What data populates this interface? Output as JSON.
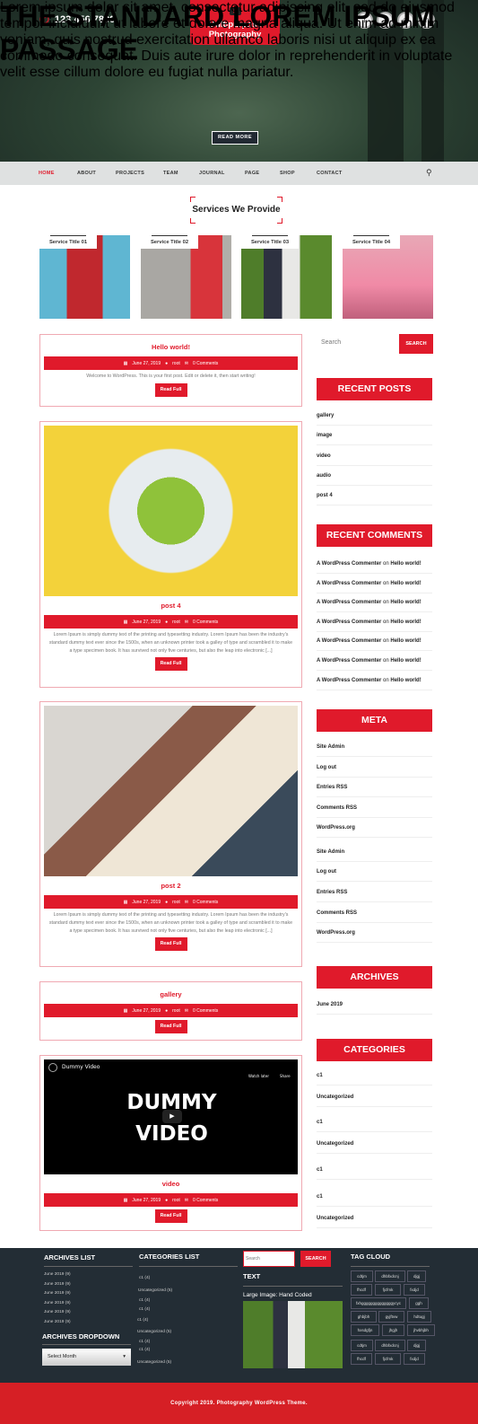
{
  "header": {
    "phone": "123 456 7890",
    "logo_line1": "Multipurpose",
    "logo_line2": "Photography",
    "social": [
      "facebook-icon",
      "twitter-icon",
      "instagram-icon",
      "linkedin-icon"
    ]
  },
  "hero": {
    "title": "THE STANDARD LOREM IPSUM PASSAGE",
    "text": "Lorem ipsum dolor sit amet, consectetur adipiscing elit, sed do eiusmod tempor incididunt ut labore et dolore magna aliqua. Ut enim ad minim veniam, quis nostrud exercitation ullamco laboris nisi ut aliquip ex ea commodo consequat. Duis aute irure dolor in reprehenderit in voluptate velit esse cillum dolore eu fugiat nulla pariatur.",
    "button": "READ MORE"
  },
  "nav": {
    "items": [
      "HOME",
      "ABOUT",
      "PROJECTS",
      "TEAM",
      "JOURNAL",
      "PAGE",
      "SHOP",
      "CONTACT"
    ],
    "active": "HOME"
  },
  "services": {
    "heading": "Services We Provide",
    "items": [
      "Service Title 01",
      "Service Title 02",
      "Service Title 03",
      "Service Title 04"
    ]
  },
  "posts": [
    {
      "title": "Hello world!",
      "date": "June 27, 2019",
      "author": "root",
      "comments": "0 Comments",
      "excerpt": "Welcome to WordPress. This is your first post. Edit or delete it, then start writing!",
      "button": "Read Full"
    },
    {
      "title": "post 4",
      "date": "June 27, 2019",
      "author": "root",
      "comments": "0 Comments",
      "excerpt": "Lorem Ipsum is simply dummy text of the printing and typesetting industry. Lorem Ipsum has been the industry's standard dummy text ever since the 1500s, when an unknown printer took a galley of type and scrambled it to make a type specimen book. It has survived not only five centuries, but also the leap into electronic [...]",
      "button": "Read Full"
    },
    {
      "title": "post 2",
      "date": "June 27, 2019",
      "author": "root",
      "comments": "0 Comments",
      "excerpt": "Lorem Ipsum is simply dummy text of the printing and typesetting industry. Lorem Ipsum has been the industry's standard dummy text ever since the 1500s, when an unknown printer took a galley of type and scrambled it to make a type specimen book. It has survived not only five centuries, but also the leap into electronic [...]",
      "button": "Read Full"
    },
    {
      "title": "gallery",
      "date": "June 27, 2019",
      "author": "root",
      "comments": "0 Comments",
      "button": "Read Full"
    },
    {
      "title": "video",
      "date": "June 27, 2019",
      "author": "root",
      "comments": "0 Comments",
      "button": "Read Full",
      "video": {
        "channel_title": "Dummy Video",
        "big_text_1": "DUMMY",
        "big_text_2": "VIDEO",
        "watch_later": "Watch later",
        "share": "Share"
      }
    }
  ],
  "sidebar": {
    "search_placeholder": "Search",
    "search_button": "SEARCH",
    "recent_posts_title": "RECENT POSTS",
    "recent_posts": [
      "gallery",
      "image",
      "video",
      "audio",
      "post 4"
    ],
    "recent_comments_title": "RECENT COMMENTS",
    "recent_comments": {
      "author": "A WordPress Commenter",
      "on": "on",
      "post": "Hello world!",
      "count": 7
    },
    "meta_title": "META",
    "meta": [
      "Site Admin",
      "Log out",
      "Entries RSS",
      "Comments RSS",
      "WordPress.org",
      "Site Admin",
      "Log out",
      "Entries RSS",
      "Comments RSS",
      "WordPress.org"
    ],
    "archives_title": "ARCHIVES",
    "archives": [
      "June 2019"
    ],
    "categories_title": "CATEGORIES",
    "categories": [
      "c1",
      "Uncategorized",
      "c1",
      "Uncategorized",
      "c1",
      "c1",
      "Uncategorized"
    ]
  },
  "footer": {
    "archives_list_title": "ARCHIVES LIST",
    "archives_list": [
      "June 2019 (9)",
      "June 2019 (9)",
      "June 2019 (9)",
      "June 2019 (9)",
      "June 2019 (9)",
      "June 2019 (9)"
    ],
    "archives_dropdown_title": "ARCHIVES DROPDOWN",
    "archives_dropdown_value": "Select Month",
    "categories_list_title": "CATEGORIES LIST",
    "categories_list": [
      "c1 (4)",
      "Uncategorized (5)",
      "c1 (4)",
      "c1 (4)",
      "c1 (4)",
      "Uncategorized (5)",
      "c1 (4)",
      "c1 (4)",
      "Uncategorized (5)"
    ],
    "search_placeholder": "Search",
    "search_button": "SEARCH",
    "text_title": "TEXT",
    "text_caption": "Large Image: Hand Coded",
    "tag_cloud_title": "TAG CLOUD",
    "tags": [
      "cdtjm",
      "dhbfxdcnj",
      "djgj",
      "fhcdf",
      "fjcfmk",
      "fxdjd",
      "fxhggggggggggggggycyc",
      "ggh",
      "ghbjbh",
      "gyjftvw",
      "hdtugj",
      "hxsdgfjn",
      "jhgjh",
      "jhvbhjbh",
      "cdtjm",
      "dhbfxdcnj",
      "djgj",
      "fhcdf",
      "fjcfmk",
      "fxdjd"
    ],
    "copyright": "Copyright 2019. Photography WordPress Theme."
  },
  "colors": {
    "accent": "#e01a2b",
    "footer_bg": "#232d35",
    "nav_bg": "#dfe1e1"
  }
}
